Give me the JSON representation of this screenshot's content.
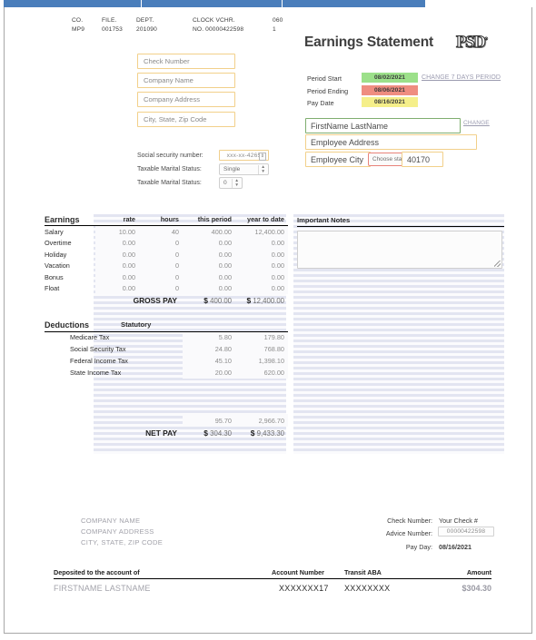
{
  "topbar": {
    "segments": 3
  },
  "meta": {
    "headers": [
      "CO.",
      "FILE.",
      "DEPT.",
      "CLOCK VCHR.",
      "060"
    ],
    "values": [
      "MP9",
      "001753",
      "201090",
      "NO. 00000422598",
      "1"
    ]
  },
  "company_fields": [
    {
      "name": "check-number-input",
      "placeholder": "Check Number"
    },
    {
      "name": "company-name-input",
      "placeholder": "Company Name"
    },
    {
      "name": "company-address-input",
      "placeholder": "Company Address"
    },
    {
      "name": "company-city-input",
      "placeholder": "City, State, Zip Code"
    }
  ],
  "ssn": {
    "label": "Social security number:",
    "value": "xxx-xx-4265",
    "stepper_glyph": "⇕"
  },
  "marital": {
    "label_1": "Taxable Marital Status:",
    "value_1": "Single",
    "label_2": "Taxable Marital Status:",
    "value_2": "0"
  },
  "statement": {
    "title": "Earnings Statement",
    "logo_text": "PSD",
    "logo_reg": "®"
  },
  "period": {
    "rows": [
      {
        "label": "Period Start",
        "value": "08/02/2021",
        "color": "#9ce08a"
      },
      {
        "label": "Period Ending",
        "value": "08/06/2021",
        "color": "#ef8d80"
      },
      {
        "label": "Pay Date",
        "value": "08/16/2021",
        "color": "#f5ef8a"
      }
    ],
    "change_link": "CHANGE 7 DAYS PERIOD"
  },
  "employee": {
    "name": "FirstName LastName",
    "change_link": "CHANGE",
    "address": "Employee Address",
    "city": "Employee City",
    "state": "Choose state",
    "zip": "40170"
  },
  "earnings": {
    "header_label": "Earnings",
    "columns": [
      "rate",
      "hours",
      "this period",
      "year to date"
    ],
    "rows": [
      {
        "name": "Salary",
        "rate": "10.00",
        "hours": "40",
        "this_period": "400.00",
        "ytd": "12,400.00"
      },
      {
        "name": "Overtime",
        "rate": "0.00",
        "hours": "0",
        "this_period": "0.00",
        "ytd": "0.00"
      },
      {
        "name": "Holiday",
        "rate": "0.00",
        "hours": "0",
        "this_period": "0.00",
        "ytd": "0.00"
      },
      {
        "name": "Vacation",
        "rate": "0.00",
        "hours": "0",
        "this_period": "0.00",
        "ytd": "0.00"
      },
      {
        "name": "Bonus",
        "rate": "0.00",
        "hours": "0",
        "this_period": "0.00",
        "ytd": "0.00"
      },
      {
        "name": "Float",
        "rate": "0.00",
        "hours": "0",
        "this_period": "0.00",
        "ytd": "0.00"
      }
    ],
    "total_label": "GROSS PAY",
    "total_currency": "$",
    "total_this_period": "400.00",
    "total_ytd": "12,400.00"
  },
  "deductions": {
    "header_label": "Deductions",
    "group_label": "Statutory",
    "rows": [
      {
        "name": "Medicare Tax",
        "this_period": "5.80",
        "ytd": "179.80"
      },
      {
        "name": "Social Security Tax",
        "this_period": "24.80",
        "ytd": "768.80"
      },
      {
        "name": "Federal Income Tax",
        "this_period": "45.10",
        "ytd": "1,398.10"
      },
      {
        "name": "State Income Tax",
        "this_period": "20.00",
        "ytd": "620.00"
      }
    ],
    "subtotal_this_period": "95.70",
    "subtotal_ytd": "2,966.70",
    "net_label": "NET PAY",
    "net_currency": "$",
    "net_this_period": "304.30",
    "net_ytd": "9,433.30"
  },
  "notes": {
    "header": "Important Notes",
    "value": ""
  },
  "company_block": {
    "line1": "COMPANY NAME",
    "line2": "COMPANY ADDRESS",
    "line3": "CITY, STATE, ZIP CODE"
  },
  "check_info": {
    "label_check": "Check Number:",
    "value_check": "Your Check #",
    "label_advice": "Advice Number:",
    "value_advice": "00000422598",
    "label_payday": "Pay Day:",
    "value_payday": "08/16/2021"
  },
  "deposit": {
    "headers": [
      "Deposited to the account of",
      "Account Number",
      "Transit ABA",
      "Amount"
    ],
    "name": "FIRSTNAME LASTNAME",
    "account_number": "XXXXXXX17",
    "transit_aba": "XXXXXXXX",
    "amount": "$304.30"
  }
}
